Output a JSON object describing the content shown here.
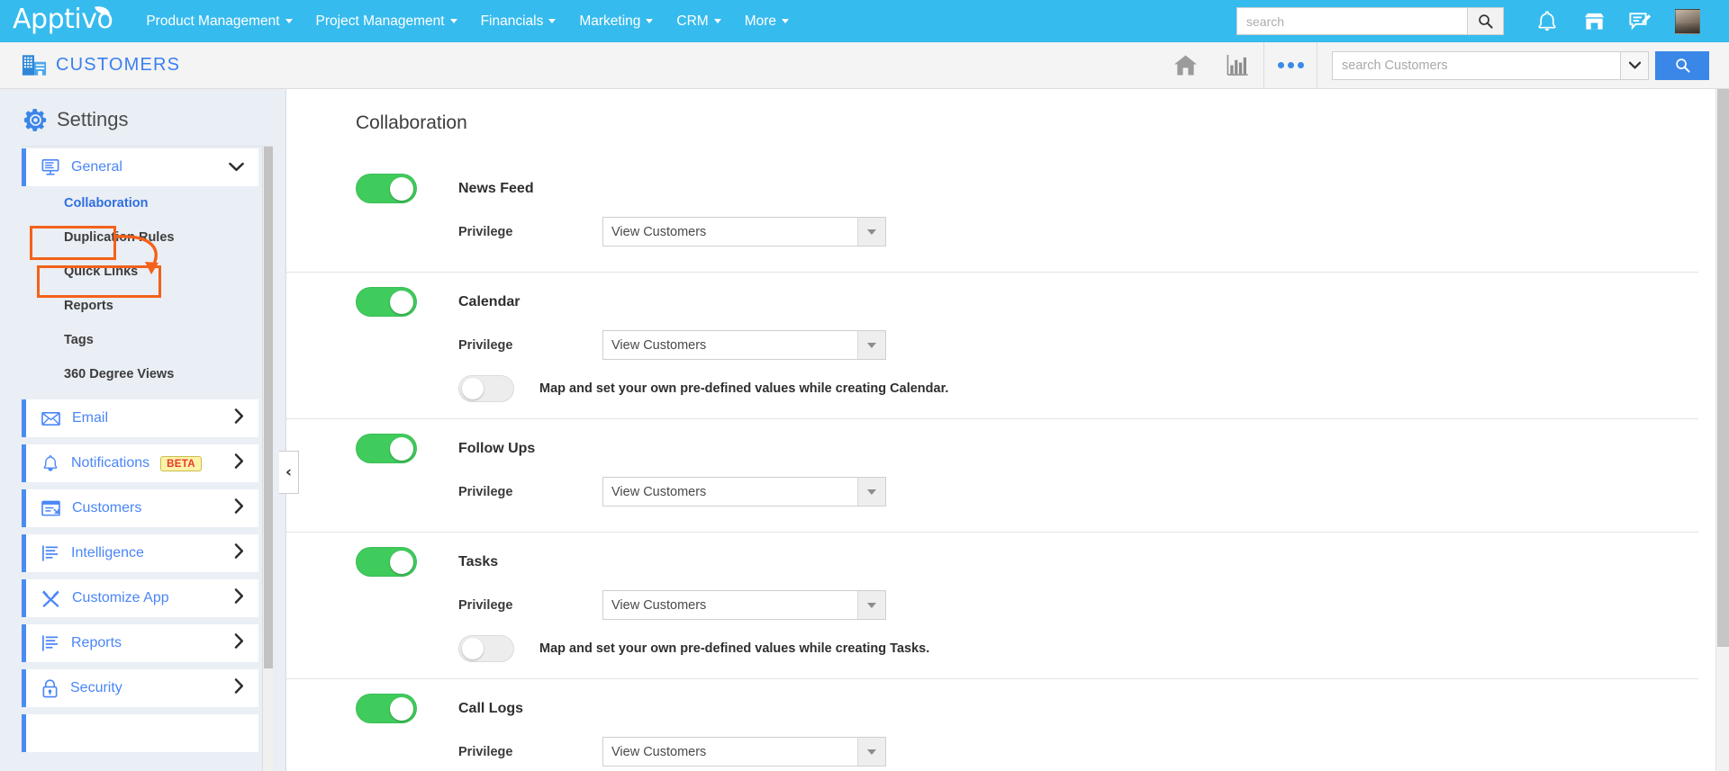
{
  "topnav": {
    "brand": "Apptivo",
    "menu": [
      {
        "label": "Product Management"
      },
      {
        "label": "Project Management"
      },
      {
        "label": "Financials"
      },
      {
        "label": "Marketing"
      },
      {
        "label": "CRM"
      },
      {
        "label": "More"
      }
    ],
    "search_placeholder": "search",
    "search_value": "",
    "icons": {
      "search": "search-icon",
      "bell": "bell-icon",
      "store": "store-icon",
      "notepad": "notepad-pencil-icon",
      "avatar": "user-avatar"
    },
    "colors": {
      "background": "#36bbee"
    }
  },
  "appbar": {
    "title": "CUSTOMERS",
    "title_color": "#3a7ff0",
    "icons": {
      "home": "home-icon",
      "chart": "bar-chart-icon",
      "more": "more-dots-icon",
      "app": "building-icon"
    },
    "search_placeholder": "search Customers",
    "search_value": ""
  },
  "sidebar": {
    "title": "Settings",
    "gear_icon": "gear-icon",
    "general": {
      "label": "General",
      "icon": "monitor-icon",
      "chevron": "chevron-down-icon",
      "expanded": true,
      "children": [
        {
          "label": "Collaboration",
          "active": true
        },
        {
          "label": "Duplication Rules",
          "active": false
        },
        {
          "label": "Quick Links",
          "active": false
        },
        {
          "label": "Reports",
          "active": false
        },
        {
          "label": "Tags",
          "active": false
        },
        {
          "label": "360 Degree Views",
          "active": false
        }
      ]
    },
    "items": [
      {
        "label": "Email",
        "icon": "envelope-icon",
        "badge": null
      },
      {
        "label": "Notifications",
        "icon": "bell-outline-icon",
        "badge": "BETA"
      },
      {
        "label": "Customers",
        "icon": "customers-card-icon",
        "badge": null
      },
      {
        "label": "Intelligence",
        "icon": "document-lines-icon",
        "badge": null
      },
      {
        "label": "Customize App",
        "icon": "tools-icon",
        "badge": null
      },
      {
        "label": "Reports",
        "icon": "document-lines-icon",
        "badge": null
      },
      {
        "label": "Security",
        "icon": "lock-icon",
        "badge": null
      }
    ],
    "collapse_handle": "‹",
    "annotation_color": "#f4611a"
  },
  "content": {
    "heading": "Collaboration",
    "privilege_label": "Privilege",
    "sections": [
      {
        "name": "News Feed",
        "enabled": true,
        "privilege_value": "View Customers",
        "map_toggle": null,
        "map_text": null
      },
      {
        "name": "Calendar",
        "enabled": true,
        "privilege_value": "View Customers",
        "map_toggle": false,
        "map_text": "Map and set your own pre-defined values while creating Calendar."
      },
      {
        "name": "Follow Ups",
        "enabled": true,
        "privilege_value": "View Customers",
        "map_toggle": null,
        "map_text": null
      },
      {
        "name": "Tasks",
        "enabled": true,
        "privilege_value": "View Customers",
        "map_toggle": false,
        "map_text": "Map and set your own pre-defined values while creating Tasks."
      },
      {
        "name": "Call Logs",
        "enabled": true,
        "privilege_value": "View Customers",
        "map_toggle": null,
        "map_text": null
      }
    ]
  }
}
